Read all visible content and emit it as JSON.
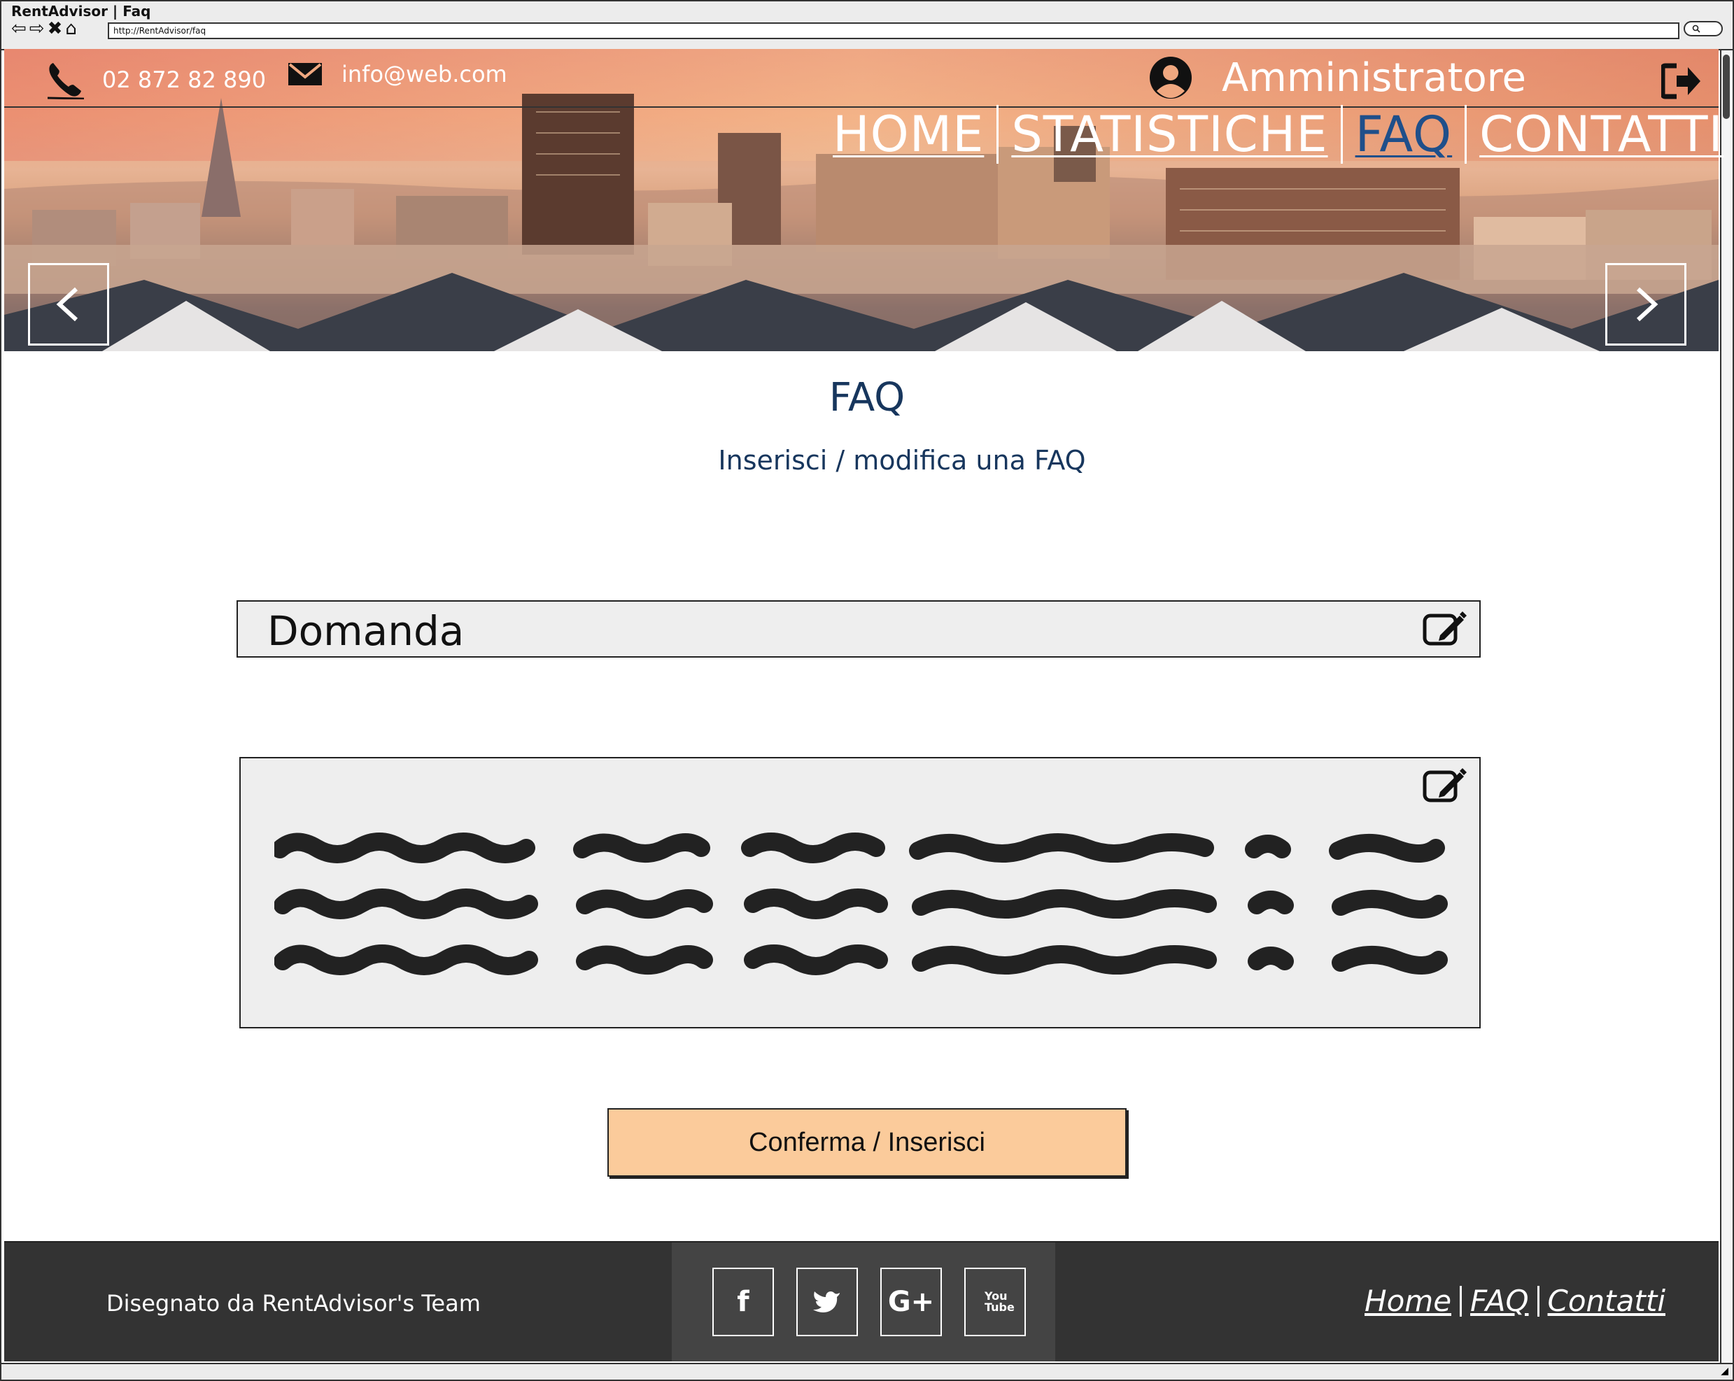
{
  "window": {
    "title": "RentAdvisor | Faq",
    "url": "http://RentAdvisor/faq"
  },
  "header": {
    "phone": "02 872 82 890",
    "email": "info@web.com",
    "user_label": "Amministratore"
  },
  "nav": {
    "items": [
      {
        "label": "HOME",
        "active": false
      },
      {
        "label": "STATISTICHE",
        "active": false
      },
      {
        "label": "FAQ",
        "active": true
      },
      {
        "label": "CONTATTI",
        "active": false
      }
    ]
  },
  "main": {
    "title": "FAQ",
    "subtitle": "Inserisci / modifica una FAQ",
    "question_label": "Domanda",
    "confirm_label": "Conferma / Inserisci"
  },
  "footer": {
    "credits": "Disegnato da RentAdvisor's Team",
    "social": [
      "f",
      "t",
      "G+",
      "You Tube"
    ],
    "links": [
      "Home",
      "FAQ",
      "Contatti"
    ]
  },
  "colors": {
    "title_blue": "#17365d",
    "active_nav": "#1f4f8a",
    "button_peach": "#fbcb9b",
    "footer_dark": "#333333",
    "field_gray": "#eeeeee"
  },
  "icons": [
    "back-arrow-icon",
    "forward-arrow-icon",
    "stop-icon",
    "home-icon",
    "search-icon",
    "phone-icon",
    "mail-icon",
    "user-icon",
    "logout-icon",
    "chevron-left-icon",
    "chevron-right-icon",
    "edit-icon",
    "facebook-icon",
    "twitter-icon",
    "google-plus-icon",
    "youtube-icon"
  ]
}
